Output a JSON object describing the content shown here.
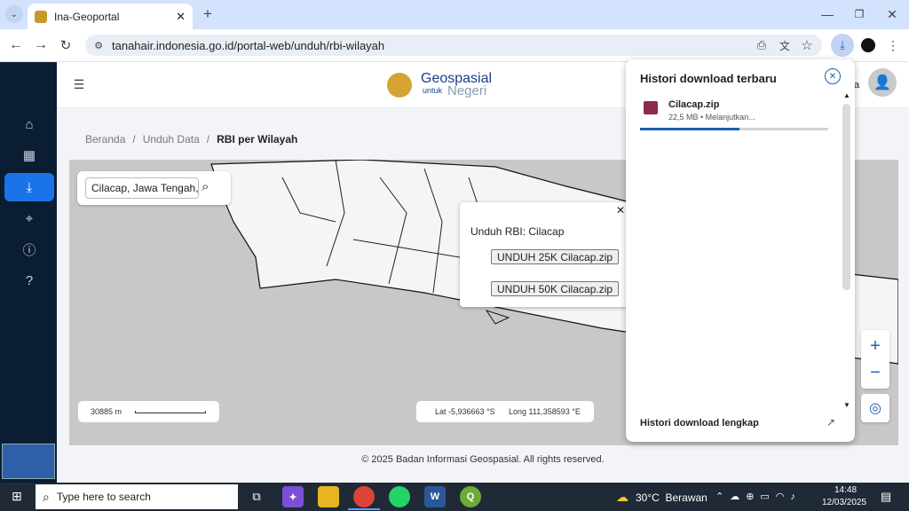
{
  "browser": {
    "tab_title": "Ina-Geoportal",
    "url": "tanahair.indonesia.go.id/portal-web/unduh/rbi-wilayah"
  },
  "app": {
    "logo_line1": "Geospasial",
    "logo_line2a": "untuk",
    "logo_line2b": "Negeri",
    "user_name_fragment": "a"
  },
  "breadcrumb": {
    "items": [
      "Beranda",
      "/",
      "Unduh Data",
      "/"
    ],
    "current": "RBI per Wilayah"
  },
  "search": {
    "value": "Cilacap, Jawa Tengah, J"
  },
  "popup": {
    "title": "Unduh RBI: Cilacap",
    "btn_25k": "UNDUH 25K Cilacap.zip",
    "btn_50k": "UNDUH 50K Cilacap.zip"
  },
  "map": {
    "scale_text": "30885 m",
    "lat": "Lat -5,936663 °S",
    "long": "Long 111,358593 °E"
  },
  "footer": {
    "text": "© 2025 Badan Informasi Geospasial. All rights reserved."
  },
  "downloads": {
    "title": "Histori download terbaru",
    "file_name": "Cilacap.zip",
    "file_status": "22,5 MB • Melanjutkan...",
    "progress": 0.53,
    "footer_link": "Histori download lengkap"
  },
  "taskbar": {
    "search_placeholder": "Type here to search",
    "weather": "30°C  Berawan",
    "time": "14:48",
    "date": "12/03/2025"
  },
  "colors": {
    "accent": "#1a73e8",
    "sidebar": "#0b1d33",
    "progress": "#1a5fb4"
  }
}
